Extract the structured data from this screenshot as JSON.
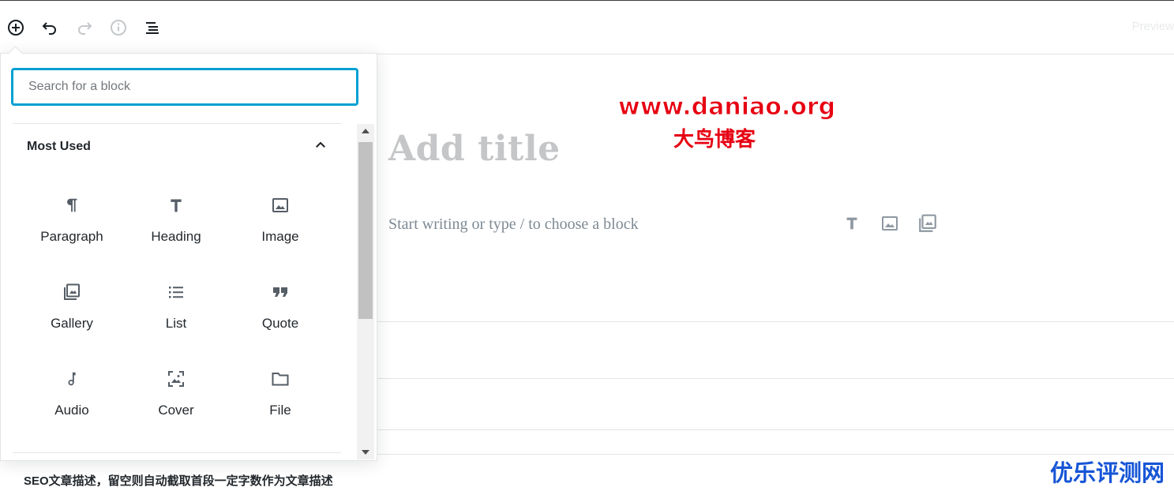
{
  "toolbar": {
    "preview_label": "Preview",
    "icons": [
      "add-block-icon",
      "undo-icon",
      "redo-icon",
      "info-icon",
      "outline-icon"
    ]
  },
  "editor": {
    "title_placeholder": "Add title",
    "paragraph_placeholder": "Start writing or type / to choose a block",
    "inline_inserter_icons": [
      "heading-icon",
      "image-icon",
      "gallery-icon"
    ]
  },
  "inserter": {
    "search_placeholder": "Search for a block",
    "panel_title": "Most Used",
    "blocks": [
      {
        "label": "Paragraph",
        "icon": "paragraph-icon"
      },
      {
        "label": "Heading",
        "icon": "heading-icon"
      },
      {
        "label": "Image",
        "icon": "image-icon"
      },
      {
        "label": "Gallery",
        "icon": "gallery-icon"
      },
      {
        "label": "List",
        "icon": "list-icon"
      },
      {
        "label": "Quote",
        "icon": "quote-icon"
      },
      {
        "label": "Audio",
        "icon": "audio-icon"
      },
      {
        "label": "Cover",
        "icon": "cover-icon"
      },
      {
        "label": "File",
        "icon": "file-icon"
      }
    ]
  },
  "watermark": {
    "url": "www.daniao.org",
    "name": "大鸟博客",
    "color": "#e60012"
  },
  "meta_box": {
    "seo_label": "SEO文章描述，留空则自动截取首段一定字数作为文章描述"
  },
  "brand": {
    "text": "优乐评测网",
    "color": "#1655d6"
  },
  "colors": {
    "accent": "#00a0d2",
    "icon": "#555d66"
  }
}
